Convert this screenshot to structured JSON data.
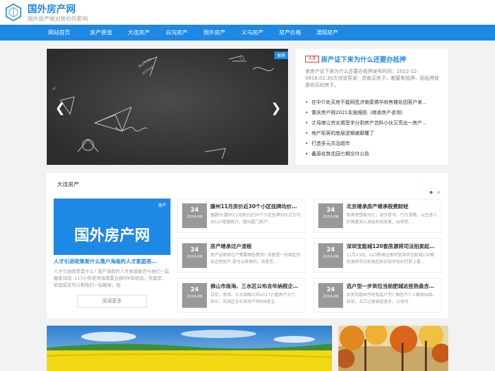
{
  "site": {
    "title": "国外房产网",
    "subtitle": "国外房产税对房价的影响"
  },
  "nav": [
    {
      "label": "网站首页"
    },
    {
      "label": "房产原值"
    },
    {
      "label": "大连房产"
    },
    {
      "label": "白沟房产"
    },
    {
      "label": "国外房产"
    },
    {
      "label": "义乌房产"
    },
    {
      "label": "房产价格"
    },
    {
      "label": "溧阳房产"
    }
  ],
  "slider": {
    "badge": "推荐",
    "prev_icon": "chevron-left-icon",
    "next_icon": "chevron-right-icon"
  },
  "headline": {
    "tag": "头条",
    "title": "房产证下来为什么还要办抵押",
    "desc": "来房产证下来为什么还要办抵押发布时间：2022-12-0816:02:30次浏览导读：贷款买房子，都要有抵押，而抵押就是你买的房子。",
    "list": [
      "在中介处买房不能网签济南菜儒华府售楼处因客户来…",
      "重庆房产税2021实施细则（继承房产咨询）",
      "丈母娘让穷女婿签字分割房产岂料小伙又亮出一房产…",
      "地产拓客的底层逻辑被颠覆了",
      "打造多元共治超市",
      "鑫源名筑花园七期交付公告"
    ]
  },
  "section": {
    "title": "大连房产",
    "feature": {
      "badge": "房产",
      "image_text": "国外房产网",
      "title": "人才引进政策是什么落户海南的人才家庭恶…",
      "desc": "人才引进政策是什么? 落户海南的人才家庭能否与他们一起搬家详询: 117小符老师海南置业顾问8年经验。答案是，家庭成员可以和他们一起搬家。但",
      "more": "阅读更多"
    },
    "cards": [
      {
        "day": "24",
        "ym": "2024-06",
        "title": "滕州11月房价近30个小区挂牌均价…",
        "desc": "据滕州:滕州11月房价近30个小区挂牌均价过万均价k22楼盘统计，滕州厦门房产…"
      },
      {
        "day": "24",
        "ym": "2024-06",
        "title": "北京继承房产继承税费财经",
        "desc": "商界思想家冯仑，读万卷书，行万里路。以生意人的角度洞入深出地说故事，似非而…"
      },
      {
        "day": "24",
        "ym": "2024-06",
        "title": "房产继承过户流程",
        "desc": "房产证继承过户需要哪些费用? 房屋是一份固定的永远性财产,是可以继承的。但是您…"
      },
      {
        "day": "24",
        "ym": "2024-06",
        "title": "深圳宝能城120套房源将司法拍卖起…",
        "desc": "11月23日，k23新闻记者阿里深圳宝能城120套房源将司法拍卖起拍价较评估价打折上看…"
      },
      {
        "day": "24",
        "ym": "2024-06",
        "title": "佛山市南海、三水区公布去年纳税企…",
        "desc": "日前，南海、三水相继公布2017六盘房产大户。其中，南海区全石首房产网共8家企…"
      },
      {
        "day": "24",
        "ym": "2024-06",
        "title": "选户型一步到位当前肥城这些热盘含…",
        "desc": "买房到现如今时我选户型? 相信不少人都很纠结。目前，五口之家家庭居多，父母可…"
      }
    ],
    "dots": [
      true,
      false
    ]
  }
}
